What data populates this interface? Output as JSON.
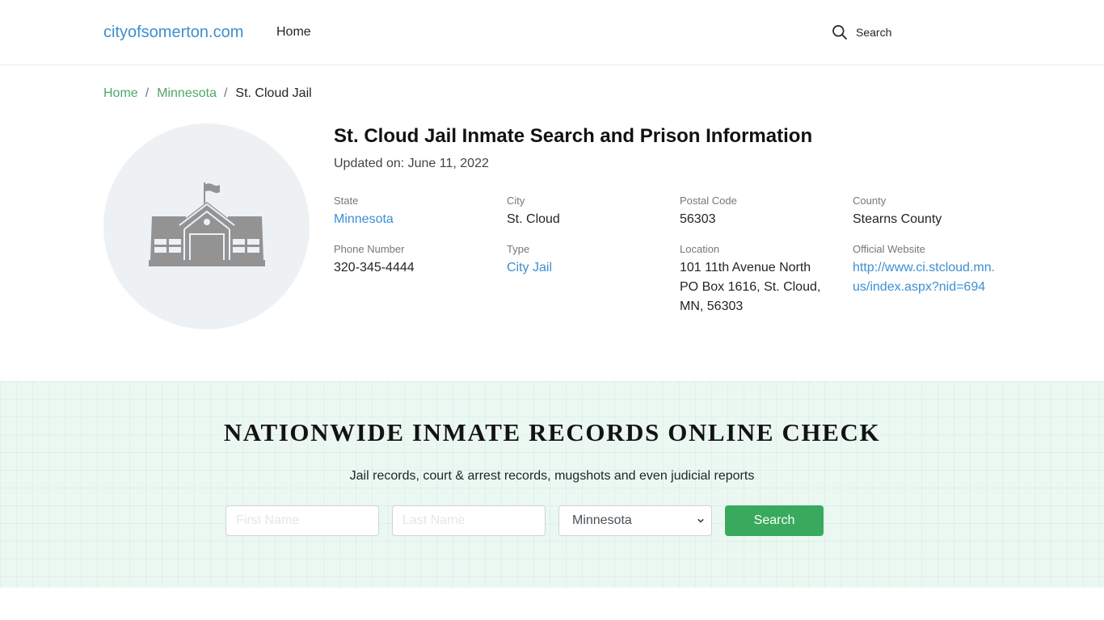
{
  "header": {
    "brand": "cityofsomerton.com",
    "nav": [
      {
        "label": "Home"
      }
    ],
    "search_label": "Search",
    "search_icon": "search-icon"
  },
  "breadcrumb": [
    {
      "label": "Home"
    },
    {
      "label": "Minnesota"
    },
    {
      "label": "St. Cloud Jail"
    }
  ],
  "breadcrumb_separator": "/",
  "facility": {
    "image_icon": "school-building-icon",
    "title": "St. Cloud Jail Inmate Search and Prison Information",
    "updated": "Updated on: June 11, 2022",
    "fields": {
      "state": {
        "label": "State",
        "value": "Minnesota"
      },
      "city": {
        "label": "City",
        "value": "St. Cloud"
      },
      "postal": {
        "label": "Postal Code",
        "value": "56303"
      },
      "county": {
        "label": "County",
        "value": "Stearns County"
      },
      "phone": {
        "label": "Phone Number",
        "value": "320-345-4444"
      },
      "type": {
        "label": "Type",
        "value": "City Jail"
      },
      "location": {
        "label": "Location",
        "value": "101 11th Avenue North PO Box 1616, St. Cloud, MN, 56303"
      },
      "website": {
        "label": "Official Website",
        "value": "http://www.ci.stcloud.mn.us/index.aspx?nid=694"
      }
    }
  },
  "search_section": {
    "title": "NATIONWIDE INMATE RECORDS ONLINE CHECK",
    "subtitle": "Jail records, court & arrest records, mugshots and even judicial reports",
    "first_name": {
      "value": "",
      "placeholder": "First Name"
    },
    "last_name": {
      "value": "",
      "placeholder": "Last Name"
    },
    "state_select": {
      "selected": "Minnesota"
    },
    "button_label": "Search",
    "colors": {
      "background": "#ebf8f2",
      "button": "#39aa5d"
    }
  },
  "colors": {
    "link": "#3d8fd1",
    "breadcrumb_link": "#4ea76a"
  }
}
